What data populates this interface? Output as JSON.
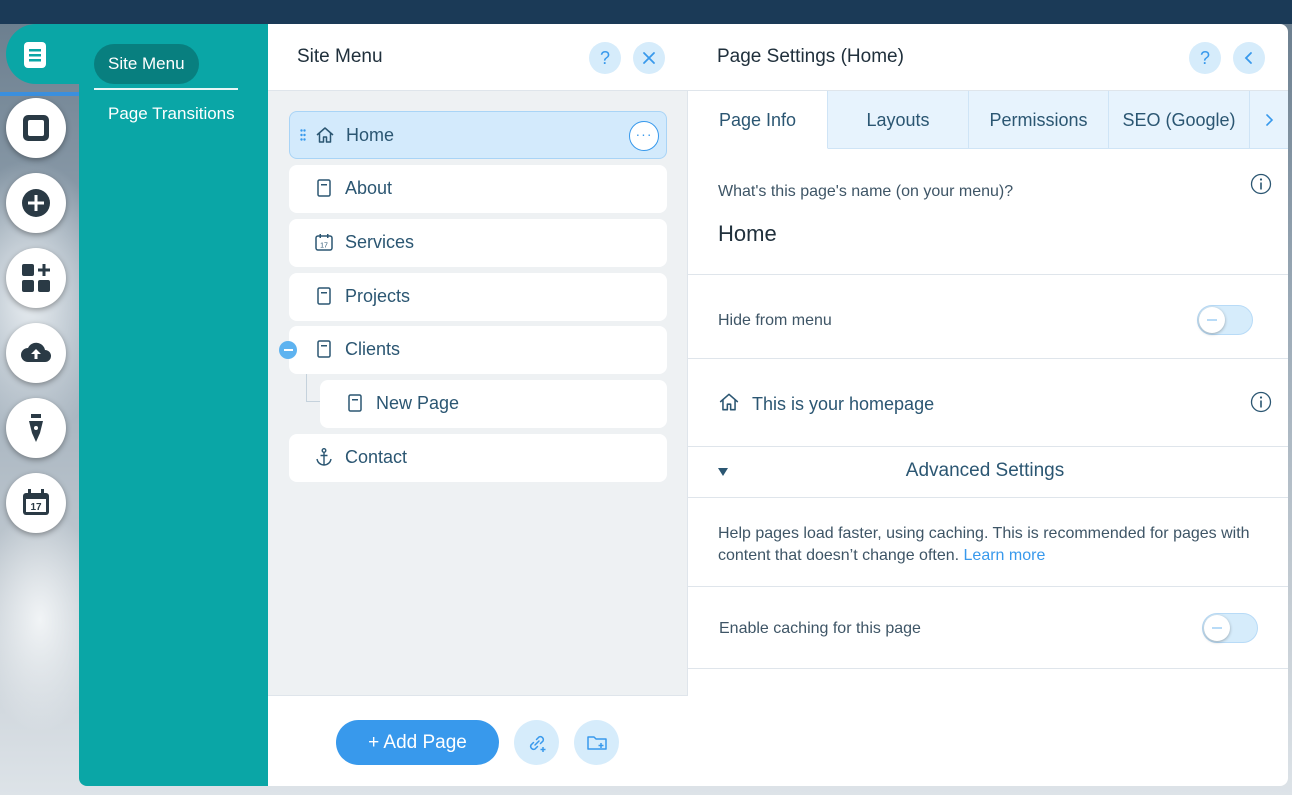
{
  "colors": {
    "teal": "#0aa6a6",
    "teal_dark": "#087f7f",
    "accent_blue": "#3899ec",
    "light_blue": "#d6ecfb",
    "text_dark": "#20303c",
    "text_navy": "#2b5672"
  },
  "left_rail": {
    "buttons": [
      {
        "icon": "pages-icon"
      },
      {
        "icon": "background-icon"
      },
      {
        "icon": "add-icon"
      },
      {
        "icon": "add-apps-icon"
      },
      {
        "icon": "upload-icon"
      },
      {
        "icon": "pen-icon"
      },
      {
        "icon": "calendar-icon"
      }
    ]
  },
  "submenu": {
    "active_label": "Site Menu",
    "items": [
      "Page Transitions"
    ]
  },
  "site_menu": {
    "title": "Site Menu",
    "help_label": "?",
    "close_label": "×",
    "pages": [
      {
        "label": "Home",
        "icon": "home-icon",
        "selected": true
      },
      {
        "label": "About",
        "icon": "page-icon"
      },
      {
        "label": "Services",
        "icon": "calendar-page-icon"
      },
      {
        "label": "Projects",
        "icon": "page-icon"
      },
      {
        "label": "Clients",
        "icon": "page-icon"
      },
      {
        "label": "New Page",
        "icon": "page-icon",
        "subpage": true
      },
      {
        "label": "Contact",
        "icon": "anchor-icon"
      }
    ],
    "more_label": "···",
    "add_page_label": "+ Add Page"
  },
  "page_settings": {
    "title": "Page Settings (Home)",
    "help_label": "?",
    "tabs": [
      "Page Info",
      "Layouts",
      "Permissions",
      "SEO (Google)"
    ],
    "active_tab": "Page Info",
    "name_question": "What's this page's name (on your menu)?",
    "name_value": "Home",
    "hide_from_menu_label": "Hide from menu",
    "hide_from_menu_on": false,
    "homepage_label": "This is your homepage",
    "advanced_label": "Advanced Settings",
    "caching_help": "Help pages load faster, using caching. This is recommended for pages with content that doesn’t change often.",
    "learn_more": "Learn more",
    "caching_label": "Enable caching for this page",
    "caching_on": false
  }
}
